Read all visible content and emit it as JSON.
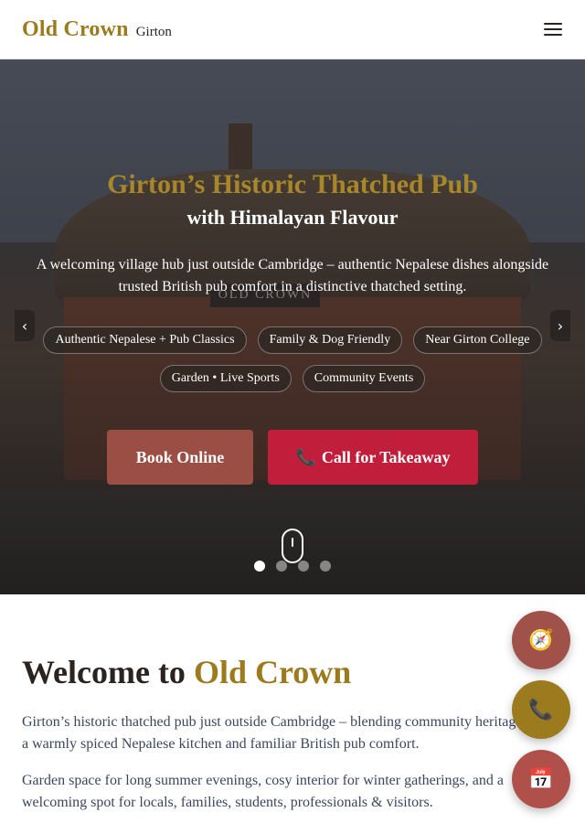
{
  "header": {
    "brand_name": "Old Crown",
    "brand_sub": "Girton",
    "menu_icon": "hamburger-menu-icon"
  },
  "hero": {
    "background_sign": "OLD CROWN",
    "title": "Girton’s Historic Thatched Pub",
    "subtitle": "with Himalayan Flavour",
    "description": "A welcoming village hub just outside Cambridge – authentic Nepalese dishes alongside trusted British pub comfort in a distinctive thatched setting.",
    "chips": [
      "Authentic Nepalese + Pub Classics",
      "Family & Dog Friendly",
      "Near Girton College",
      "Garden • Live Sports",
      "Community Events"
    ],
    "cta_book": "Book Online",
    "cta_call_icon": "📞",
    "cta_call": "Call for Takeaway",
    "prev_arrow": "‹",
    "next_arrow": "›",
    "slide_count": 4,
    "active_slide": 1
  },
  "welcome": {
    "title_prefix": "Welcome to",
    "title_accent": "Old Crown",
    "paragraph1": "Girton’s historic thatched pub just outside Cambridge – blending community heritage with a warmly spiced Nepalese kitchen and familiar British pub comfort.",
    "paragraph2": "Garden space for long summer evenings, cosy interior for winter gatherings, and a welcoming spot for locals, families, students, professionals & visitors."
  },
  "floating_buttons": {
    "directions_icon": "🧭",
    "phone_icon": "📞",
    "calendar_icon": "📅"
  },
  "colors": {
    "brand_gold": "#9c7a1e",
    "book_button": "#9b4e44",
    "call_button": "#c01e3a",
    "body_text": "#3a4660"
  }
}
